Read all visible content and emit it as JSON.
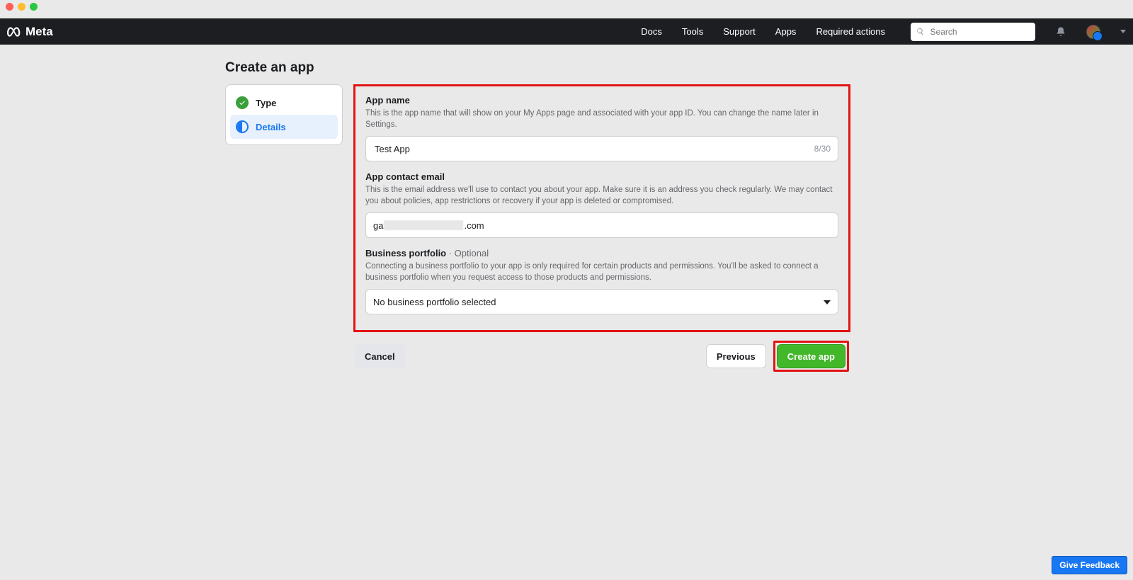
{
  "brand": "Meta",
  "nav": {
    "docs": "Docs",
    "tools": "Tools",
    "support": "Support",
    "apps": "Apps",
    "required": "Required actions"
  },
  "search": {
    "placeholder": "Search"
  },
  "page": {
    "title": "Create an app"
  },
  "steps": {
    "type": "Type",
    "details": "Details"
  },
  "form": {
    "appname": {
      "label": "App name",
      "desc": "This is the app name that will show on your My Apps page and associated with your app ID. You can change the name later in Settings.",
      "value": "Test App",
      "counter": "8/30"
    },
    "email": {
      "label": "App contact email",
      "desc": "This is the email address we'll use to contact you about your app. Make sure it is an address you check regularly. We may contact you about policies, app restrictions or recovery if your app is deleted or compromised.",
      "prefix": "ga",
      "suffix": ".com"
    },
    "portfolio": {
      "label": "Business portfolio",
      "optional": " · Optional",
      "desc": "Connecting a business portfolio to your app is only required for certain products and permissions. You'll be asked to connect a business portfolio when you request access to those products and permissions.",
      "value": "No business portfolio selected"
    }
  },
  "buttons": {
    "cancel": "Cancel",
    "previous": "Previous",
    "create": "Create app"
  },
  "feedback": "Give Feedback"
}
